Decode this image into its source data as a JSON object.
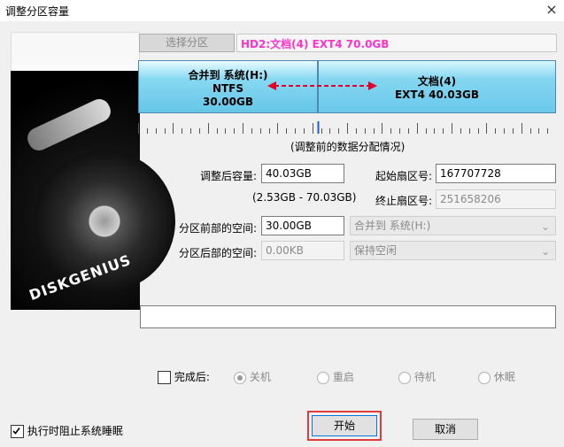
{
  "window": {
    "title": "调整分区容量",
    "close": "×"
  },
  "top": {
    "select_partition_btn": "选择分区",
    "disk_label": "HD2:文档(4) EXT4 70.0GB"
  },
  "partitions": {
    "left": {
      "name": "合并到 系统(H:)",
      "fs": "NTFS",
      "size": "30.00GB"
    },
    "right": {
      "name": "文档(4)",
      "fs_size": "EXT4 40.03GB"
    }
  },
  "caption": "(调整前的数据分配情况)",
  "form": {
    "adjusted_label": "调整后容量:",
    "adjusted_value": "40.03GB",
    "range": "(2.53GB - 70.03GB)",
    "start_sector_label": "起始扇区号:",
    "start_sector_value": "167707728",
    "end_sector_label": "终止扇区号:",
    "end_sector_value": "251658206",
    "front_space_label": "分区前部的空间:",
    "front_space_value": "30.00GB",
    "front_action": "合并到 系统(H:)",
    "back_space_label": "分区后部的空间:",
    "back_space_value": "0.00KB",
    "back_action": "保持空闲"
  },
  "after": {
    "label": "完成后:",
    "options": [
      "关机",
      "重启",
      "待机",
      "休眠"
    ],
    "selected_index": 0
  },
  "bottom": {
    "prevent_sleep_label": "执行时阻止系统睡眠",
    "prevent_sleep_checked": true,
    "start": "开始",
    "cancel": "取消"
  },
  "brand_logo_text": "DISKGENIUS",
  "colors": {
    "accent_pink": "#ff33cc",
    "highlight_red": "#e03c3c",
    "partition_blue": "#7fd3ef"
  }
}
